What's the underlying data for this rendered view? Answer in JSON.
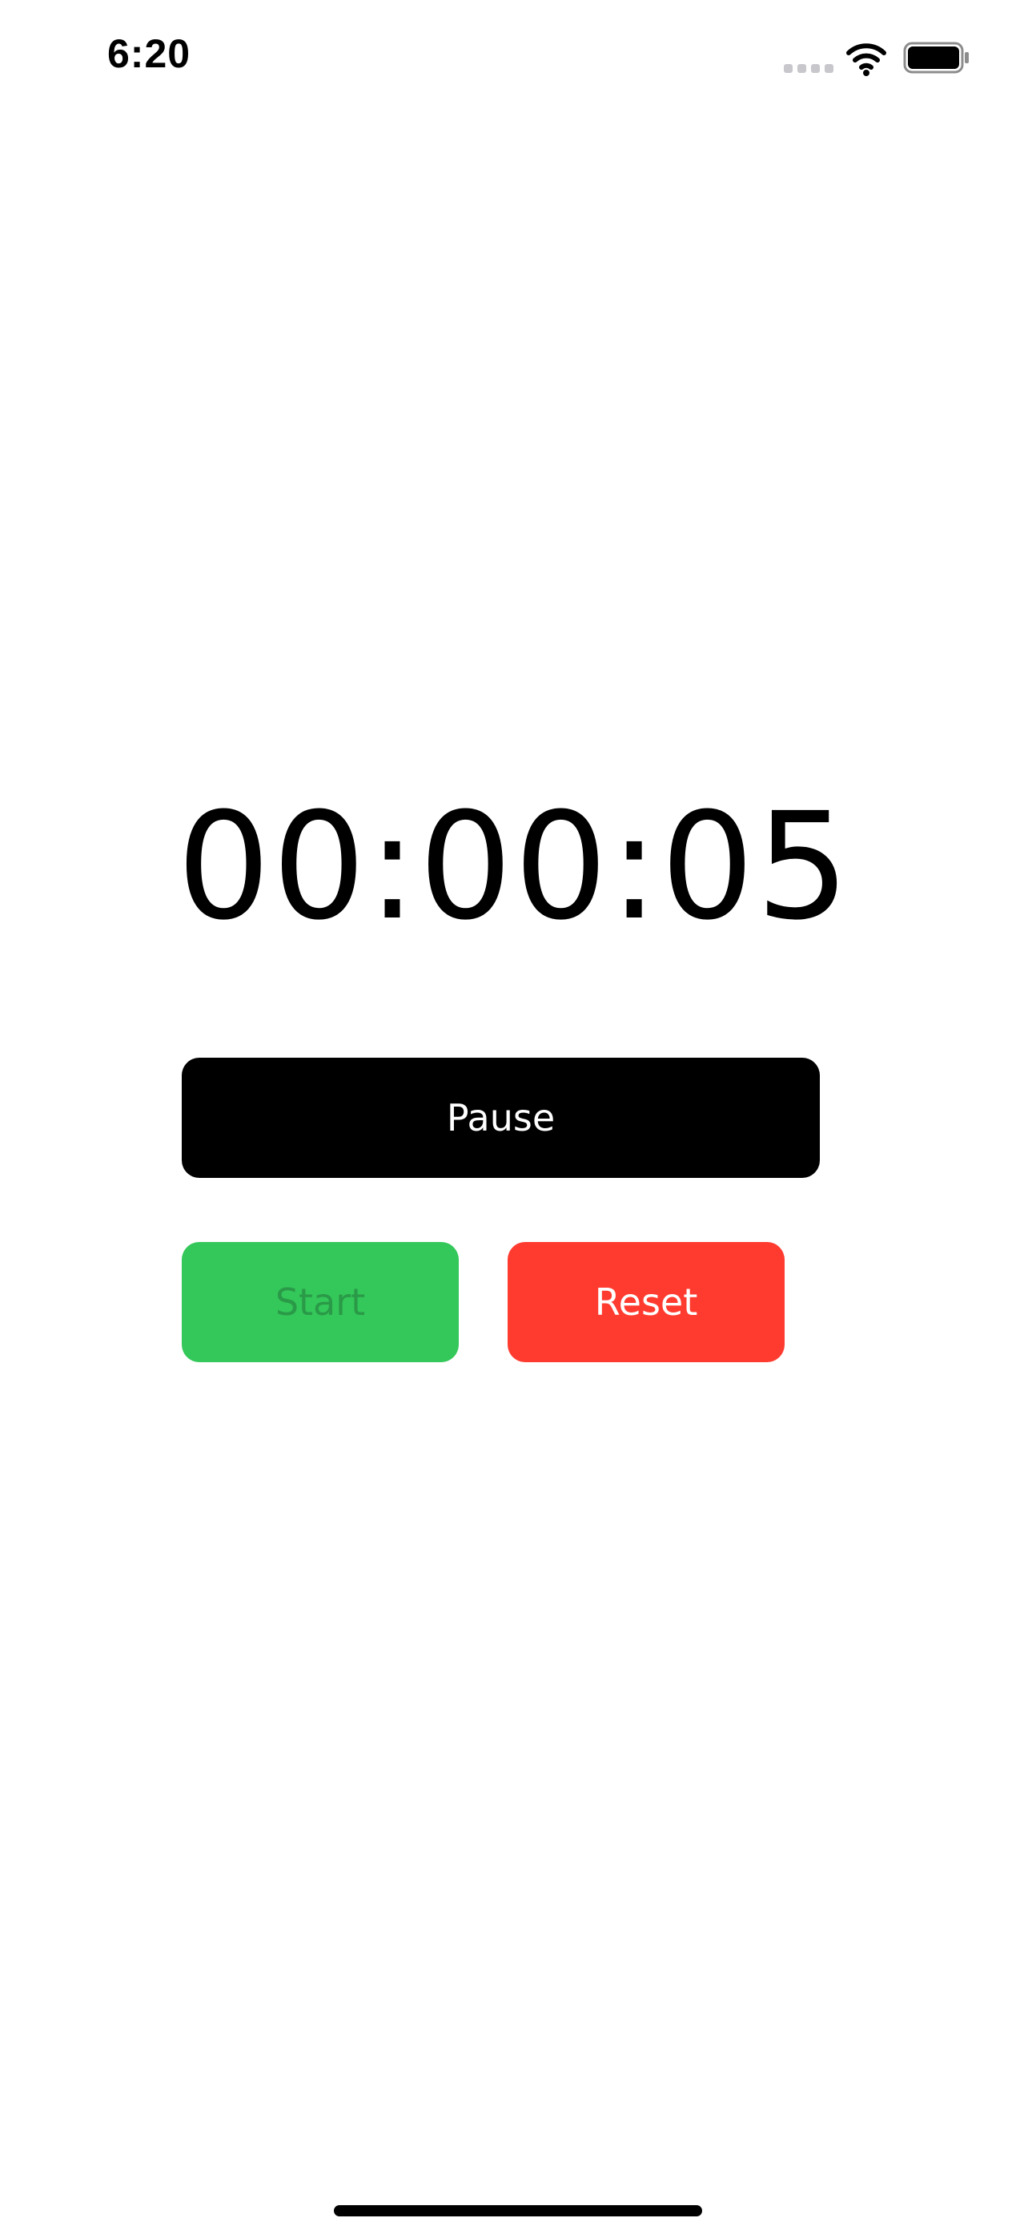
{
  "status_bar": {
    "time": "6:20",
    "icons": [
      "cellular-signal-icon",
      "wifi-icon",
      "battery-icon"
    ]
  },
  "timer": {
    "display": "00:00:05"
  },
  "controls": {
    "pause_label": "Pause",
    "start_label": "Start",
    "reset_label": "Reset"
  },
  "colors": {
    "pause_bg": "#000000",
    "start_bg": "#34c759",
    "start_text_disabled": "#2a9a48",
    "reset_bg": "#ff3b30",
    "text_light": "#ffffff"
  }
}
